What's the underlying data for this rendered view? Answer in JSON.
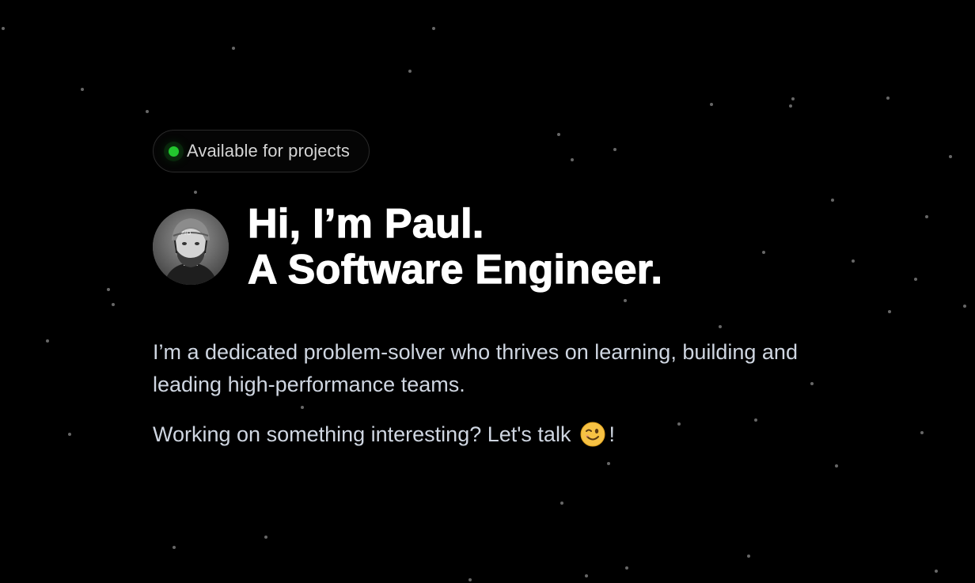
{
  "status": {
    "label": "Available for projects",
    "dot_color": "#22c52e"
  },
  "avatar": {
    "icon": "profile-photo-helmet",
    "style": "grayscale"
  },
  "headline": {
    "line1": "Hi, I’m Paul.",
    "line2": "A Software Engineer."
  },
  "bio": "I’m a dedicated problem-solver who thrives on learning, building and leading high-performance teams.",
  "cta": {
    "text": "Working on something interesting? Let's talk",
    "emoji_icon": "winking-face-icon",
    "suffix": "!"
  },
  "colors": {
    "background": "#000000",
    "headline": "#ffffff",
    "body_text": "#cfd6e1",
    "accent": "#22c52e"
  }
}
